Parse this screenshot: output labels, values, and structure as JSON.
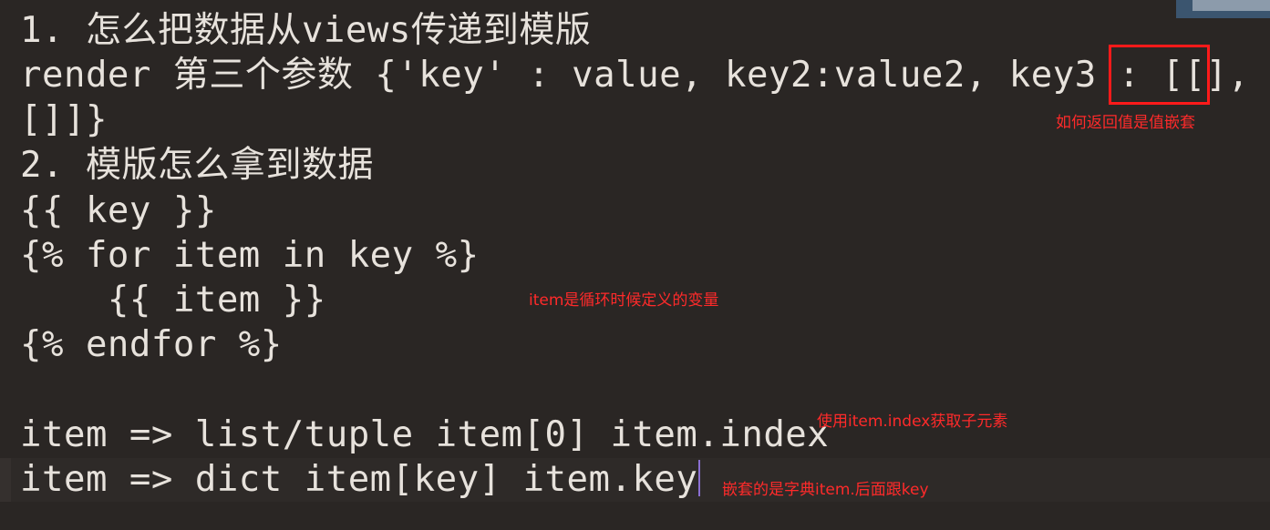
{
  "code_lines": [
    "1. 怎么把数据从views传递到模版",
    "render 第三个参数 {'key' : value, key2:value2, key3 : [[],",
    "[]]}",
    "2. 模版怎么拿到数据",
    "{{ key }}",
    "{% for item in key %}",
    "    {{ item }}",
    "{% endfor %}",
    "",
    "item => list/tuple item[0] item.index",
    "item => dict item[key] item.key"
  ],
  "annotations": {
    "nested_value": "如何返回值是值嵌套",
    "loop_variable": "item是循环时候定义的变量",
    "get_child": "使用item.index获取子元素",
    "dict_nested": "嵌套的是字典item.后面跟key"
  },
  "colors": {
    "background": "#2a2624",
    "text": "#e7e2dc",
    "annotation": "#ff2a2a",
    "highlight_box": "#ff1a1a",
    "cursor": "#8a6fd1"
  }
}
